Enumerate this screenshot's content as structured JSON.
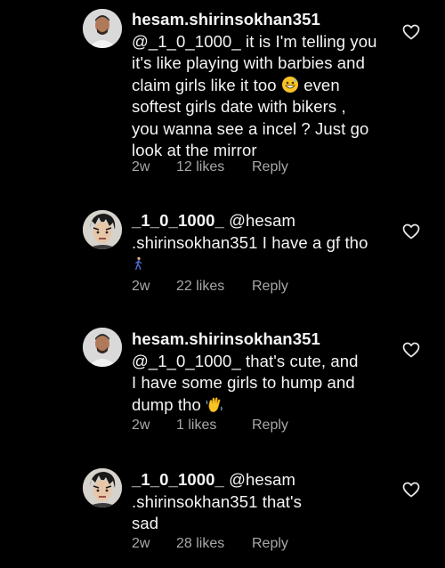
{
  "comments": [
    {
      "username": "hesam.shirinsokhan351",
      "text_lines": [
        "@_1_0_1000_ it is I'm telling you",
        "it's like playing with barbies and",
        "claim girls like it too",
        "even",
        "softest girls date with bikers ,",
        "you wanna see a incel ? Just go",
        "look at the mirror"
      ],
      "time": "2w",
      "likes": "12 likes",
      "reply": "Reply",
      "emoji": "grinning-sweat-emoji"
    },
    {
      "username": "_1_0_1000_",
      "text_lines": [
        "@hesam",
        ".shirinsokhan351 I have a gf tho"
      ],
      "time": "2w",
      "likes": "22 likes",
      "reply": "Reply",
      "emoji": "person-walking-emoji"
    },
    {
      "username": "hesam.shirinsokhan351",
      "text_lines": [
        "@_1_0_1000_ that's cute, and",
        "I have some girls to hump and",
        "dump tho"
      ],
      "time": "2w",
      "likes": "1 likes",
      "reply": "Reply",
      "emoji": "waving-hand-emoji"
    },
    {
      "username": "_1_0_1000_",
      "text_lines": [
        "@hesam",
        ".shirinsokhan351 that's",
        "sad"
      ],
      "time": "2w",
      "likes": "28 likes",
      "reply": "Reply"
    }
  ],
  "colors": {
    "background": "#000000",
    "text": "#f5f5f5",
    "meta": "#a8a8a8"
  }
}
